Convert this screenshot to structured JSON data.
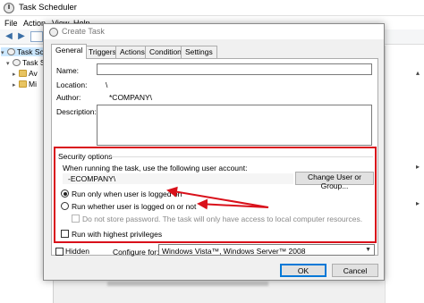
{
  "main_window": {
    "title": "Task Scheduler",
    "menu": [
      "File",
      "Action",
      "View",
      "Help"
    ],
    "tree": [
      {
        "label": "Task Sche",
        "selected": true
      },
      {
        "label": "Task S",
        "selected": false
      },
      {
        "label": "Av",
        "selected": false
      },
      {
        "label": "Mi",
        "selected": false
      }
    ]
  },
  "dialog": {
    "title": "Create Task",
    "tabs": [
      "General",
      "Triggers",
      "Actions",
      "Conditions",
      "Settings"
    ],
    "active_tab": "General",
    "general": {
      "name_label": "Name:",
      "name_value": "",
      "location_label": "Location:",
      "location_value": "\\",
      "author_label": "Author:",
      "author_value": "*COMPANY\\",
      "description_label": "Description:",
      "description_value": "",
      "security": {
        "group_label": "Security options",
        "account_prompt": "When running the task, use the following user account:",
        "account_value": "-ECOMPANY\\",
        "change_user_button": "Change User or Group...",
        "run_logged_on": "Run only when user is logged on",
        "run_logged_on_selected": true,
        "run_whether": "Run whether user is logged on or not",
        "run_whether_selected": false,
        "no_store_password": "Do not store password.  The task will only have access to local computer resources.",
        "highest_privileges": "Run with highest privileges",
        "highest_privileges_checked": false
      },
      "hidden_label": "Hidden",
      "hidden_checked": false,
      "configure_label": "Configure for:",
      "configure_value": "Windows Vista™, Windows Server™ 2008"
    },
    "ok_button": "OK",
    "cancel_button": "Cancel"
  },
  "annotation_color": "#d9101a"
}
